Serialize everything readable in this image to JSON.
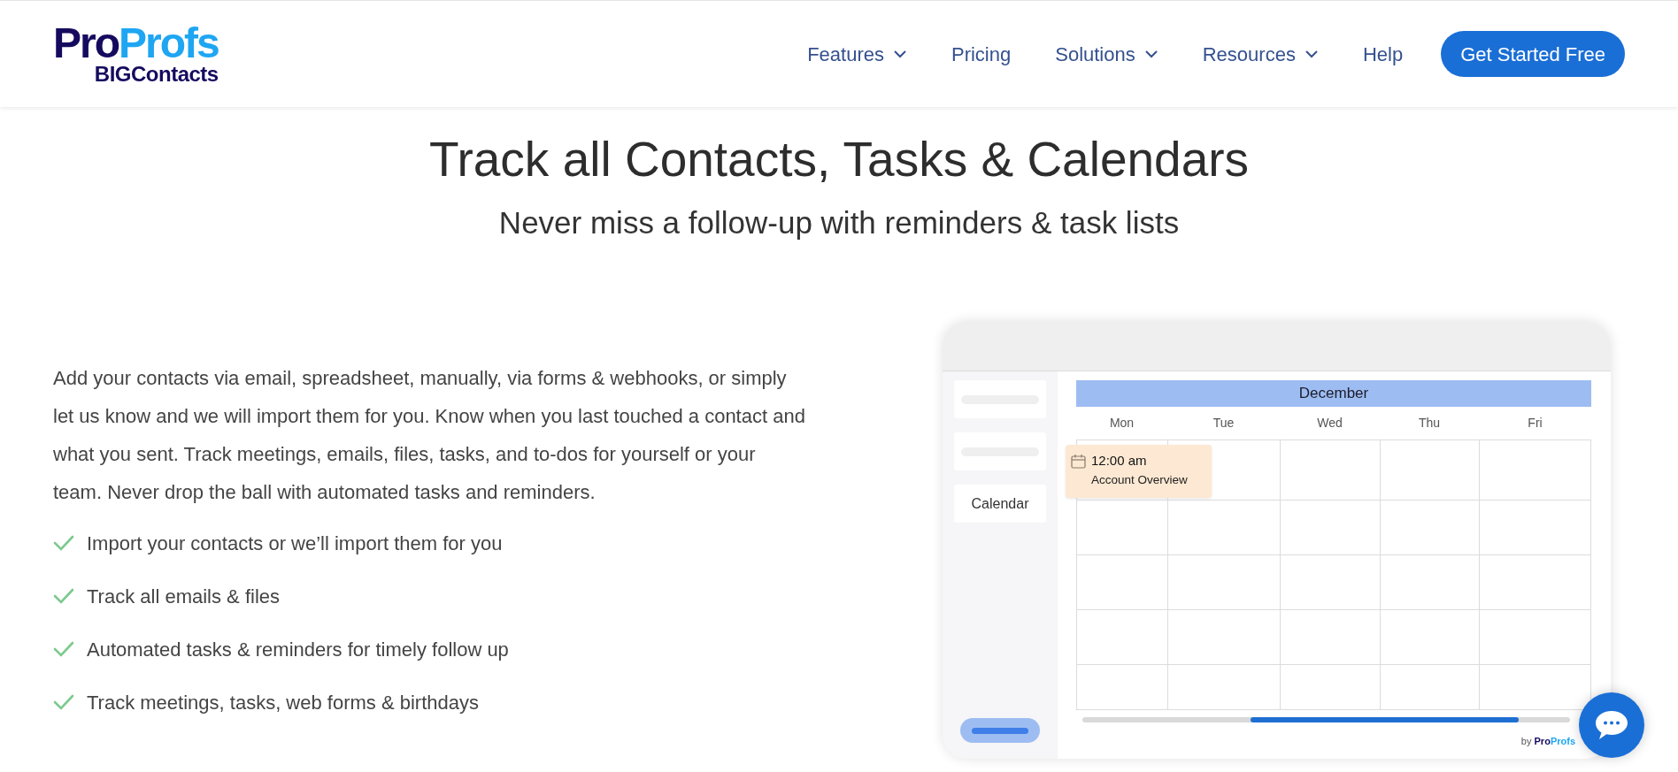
{
  "header": {
    "logo": {
      "brand_a": "Pro",
      "brand_b": "Profs",
      "product": "BIGContacts"
    },
    "nav": [
      {
        "label": "Features",
        "dropdown": true
      },
      {
        "label": "Pricing",
        "dropdown": false
      },
      {
        "label": "Solutions",
        "dropdown": true
      },
      {
        "label": "Resources",
        "dropdown": true
      },
      {
        "label": "Help",
        "dropdown": false
      }
    ],
    "cta": "Get Started Free"
  },
  "hero": {
    "title": "Track all Contacts, Tasks & Calendars",
    "subtitle": "Never miss a follow-up with reminders & task lists"
  },
  "description": "Add your contacts via email, spreadsheet, manually, via forms & webhooks, or simply let us know and we will import them for you. Know when you last touched a contact and what you sent. Track meetings, emails, files, tasks, and to-dos for yourself or your team. Never drop the ball with automated tasks and reminders.",
  "features": [
    "Import your contacts or we’ll import them for you",
    "Track all emails & files",
    "Automated tasks & reminders for timely follow up",
    "Track meetings, tasks, web forms & birthdays"
  ],
  "mockup": {
    "sidebar": [
      {
        "kind": "placeholder"
      },
      {
        "kind": "placeholder"
      },
      {
        "kind": "label",
        "label": "Calendar"
      }
    ],
    "month": "December",
    "days": [
      "Mon",
      "Tue",
      "Wed",
      "Thu",
      "Fri"
    ],
    "event": {
      "time": "12:00 am",
      "title": "Account Overview"
    },
    "footer": {
      "by": "by",
      "brand_a": "Pro",
      "brand_b": "Profs"
    }
  }
}
